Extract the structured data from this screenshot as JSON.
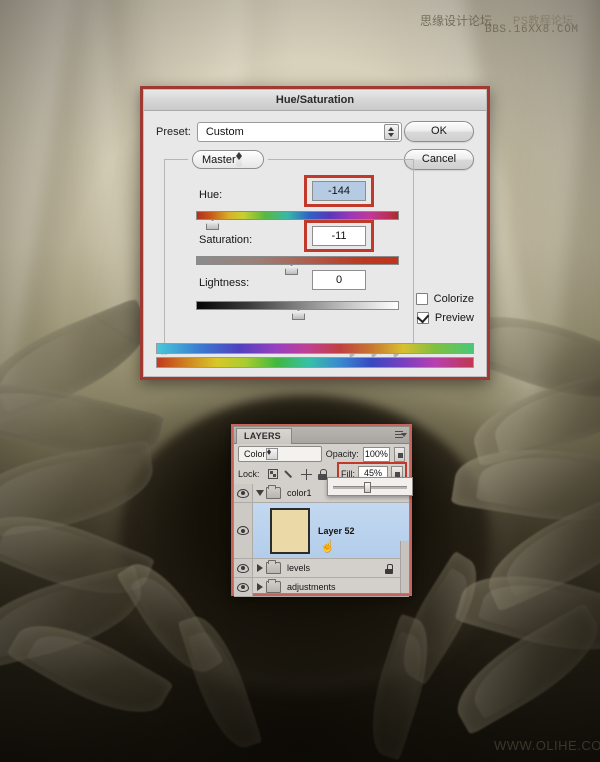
{
  "background": {
    "description": "sepia-toned fantasy illustration with drapery folds, curved vines and large leaves surrounding a dark hollow",
    "tones": {
      "top": "#ddd6c2",
      "mid": "#9f9878",
      "bottom": "#100e09"
    }
  },
  "watermarks": {
    "cn_forum": "思缘设计论坛",
    "cn_tutorial": "PS教程论坛",
    "bbs_url": "BBS.16XX8.COM",
    "site_url": "WWW.OLIHE.COM"
  },
  "hue_saturation_dialog": {
    "title": "Hue/Saturation",
    "preset_label": "Preset:",
    "preset_value": "Custom",
    "preset_menu_icon": "preset-options-icon",
    "buttons": {
      "ok": "OK",
      "cancel": "Cancel"
    },
    "channel_value": "Master",
    "sliders": [
      {
        "label": "Hue:",
        "value": "-144",
        "selected": true,
        "thumb_pct": 8,
        "track": "hue-rainbow"
      },
      {
        "label": "Saturation:",
        "value": "-11",
        "selected": false,
        "thumb_pct": 47,
        "track": "saturation-gray-red"
      },
      {
        "label": "Lightness:",
        "value": "0",
        "selected": false,
        "thumb_pct": 50,
        "track": "lightness-black-white"
      }
    ],
    "checkboxes": [
      {
        "label": "Colorize",
        "checked": false
      },
      {
        "label": "Preview",
        "checked": true
      }
    ],
    "target_adjust_icon": "on-image-adjust-hand-icon",
    "eyedroppers": [
      {
        "name": "eyedropper-icon",
        "modifier": ""
      },
      {
        "name": "eyedropper-add-icon",
        "modifier": "+"
      },
      {
        "name": "eyedropper-subtract-icon",
        "modifier": "−"
      }
    ],
    "spectrum_bars": [
      "adjusted-hue-spectrum",
      "original-hue-spectrum"
    ],
    "highlight_color": "#c0392b"
  },
  "layers_panel": {
    "tab_label": "LAYERS",
    "panel_menu_icon": "panel-menu-icon",
    "blend_mode": "Color",
    "opacity_label": "Opacity:",
    "opacity_value": "100%",
    "lock_label": "Lock:",
    "lock_icons": [
      "lock-transparent-pixels-icon",
      "lock-image-pixels-icon",
      "lock-position-icon",
      "lock-all-icon"
    ],
    "fill_label": "Fill:",
    "fill_value": "45%",
    "fill_highlight_color": "#c0392b",
    "layers": [
      {
        "name": "color1",
        "type": "group",
        "expanded": true,
        "visible": true,
        "selected": false,
        "locked": false
      },
      {
        "name": "Layer 52",
        "type": "layer",
        "visible": true,
        "selected": true,
        "locked": false,
        "thumbnail_color": "#ecd9a8"
      },
      {
        "name": "levels",
        "type": "group",
        "expanded": false,
        "visible": true,
        "selected": false,
        "locked": true
      },
      {
        "name": "adjustments",
        "type": "group",
        "expanded": false,
        "visible": true,
        "selected": false,
        "locked": false
      }
    ],
    "border_color": "#c4645c"
  }
}
